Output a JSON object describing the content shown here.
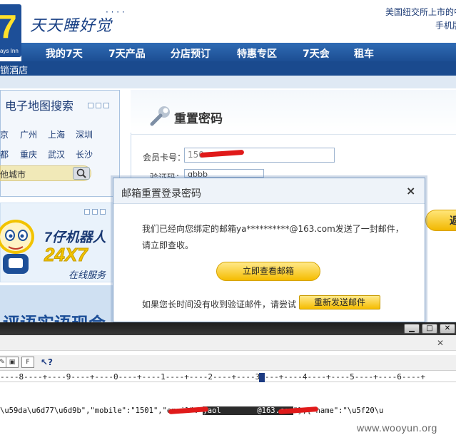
{
  "header": {
    "slogan": "天天睡好觉",
    "logo_number": "7",
    "logo_brand": "ays Inn",
    "top_note": "美国纽交所上市的中",
    "top_link": "手机版"
  },
  "nav": {
    "items": [
      "我的7天",
      "7天产品",
      "分店预订",
      "特惠专区",
      "7天会",
      "租车"
    ],
    "sub_label": "锁酒店"
  },
  "sidebar": {
    "map_title": "电子地图搜索",
    "cities_row1": [
      "京",
      "广州",
      "上海",
      "深圳"
    ],
    "cities_row2": [
      "都",
      "重庆",
      "武汉",
      "长沙"
    ],
    "city_search_placeholder": "他城市"
  },
  "promo": {
    "title": "7仔机器人",
    "badge": "24X7",
    "subtitle": "在线服务",
    "bottom_text": "评语实语现会"
  },
  "reset_form": {
    "title": "重置密码",
    "member_label": "会员卡号：",
    "member_value": "150",
    "captcha_label": "验证码：",
    "captcha_value": "qbbb",
    "side_button": "返"
  },
  "modal": {
    "title": "邮箱重置登录密码",
    "close": "×",
    "message": "我们已经向您绑定的邮箱ya**********@163.com发送了一封邮件，请立即查收。",
    "check_mail_button": "立即查看邮箱",
    "hint": "如果您长时间没有收到验证邮件，请尝试",
    "resend_button": "重新发送邮件"
  },
  "editor": {
    "min": "▁",
    "max": "□",
    "close": "✕",
    "menu_close": "✕",
    "toolbar_icons": [
      "edit-icon",
      "file-icon",
      "help-icon"
    ],
    "ruler": "----8----+----9----+----0----+----1----+----2----+----3----+----4----+----5----+----6----+",
    "text_before": "\\u59da\\u6d77\\u6d9b\",\"mobile\":\"1501",
    "text_mid": "\",\"email\":\"",
    "text_selected": "yaol        @163.com",
    "text_after": "\"},{\"name\":\"\\u5f20\\u",
    "watermark": "www.wooyun.org"
  },
  "colors": {
    "brand_blue": "#1d4f98",
    "brand_yellow": "#f5bc00",
    "redaction": "#e01a1a"
  }
}
